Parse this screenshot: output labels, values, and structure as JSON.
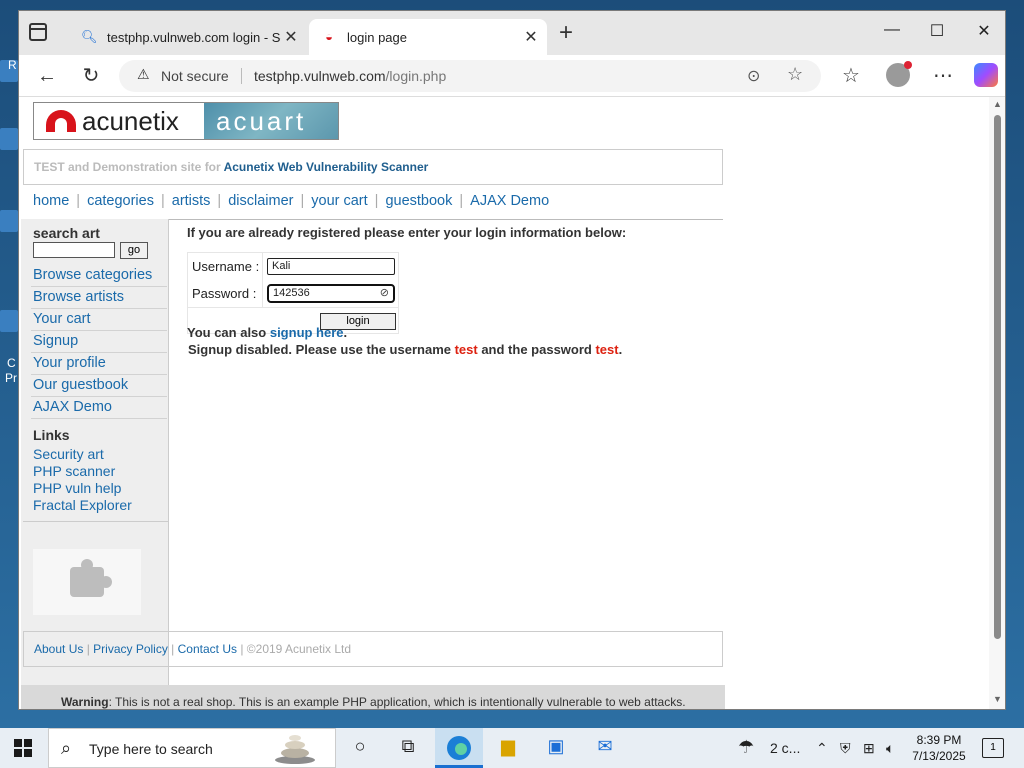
{
  "desktop": {
    "labels": [
      "R",
      "C",
      "Pr"
    ]
  },
  "browser": {
    "tabs": [
      {
        "title": "testphp.vulnweb.com login - Sear",
        "icon": "search-icon",
        "active": false
      },
      {
        "title": "login page",
        "icon": "acunetix-favicon",
        "active": true
      }
    ],
    "address": {
      "security": "Not secure",
      "host": "testphp.vulnweb.com",
      "path": "/login.php"
    }
  },
  "page": {
    "logo": {
      "left": "acunetix",
      "right": "acuart"
    },
    "subtitle": {
      "prefix": "TEST and Demonstration site for ",
      "highlight": "Acunetix Web Vulnerability Scanner"
    },
    "topnav": [
      "home",
      "categories",
      "artists",
      "disclaimer",
      "your cart",
      "guestbook",
      "AJAX Demo"
    ],
    "search": {
      "label": "search art",
      "button": "go",
      "value": ""
    },
    "left_menu": [
      "Browse categories",
      "Browse artists",
      "Your cart",
      "Signup",
      "Your profile",
      "Our guestbook",
      "AJAX Demo"
    ],
    "links_heading": "Links",
    "links": [
      "Security art",
      "PHP scanner",
      "PHP vuln help",
      "Fractal Explorer"
    ],
    "intro": "If you are already registered please enter your login information below:",
    "form": {
      "username_label": "Username :",
      "username_value": "Kali",
      "password_label": "Password :",
      "password_value": "142536",
      "submit": "login"
    },
    "also": {
      "prefix": "You can also ",
      "link": "signup here",
      "suffix": "."
    },
    "disabled": {
      "p1": "Signup disabled. Please use the username ",
      "u": "test",
      "p2": " and the password ",
      "pw": "test",
      "p3": "."
    },
    "footer": {
      "links": [
        "About Us",
        "Privacy Policy",
        "Contact Us"
      ],
      "copyright": "©2019 Acunetix Ltd"
    },
    "warning": {
      "bold": "Warning",
      "text": ": This is not a real shop. This is an example PHP application, which is intentionally vulnerable to web attacks."
    }
  },
  "taskbar": {
    "search_placeholder": "Type here to search",
    "weather": "2 c...",
    "time": "8:39 PM",
    "date": "7/13/2025",
    "notifications": "1"
  }
}
